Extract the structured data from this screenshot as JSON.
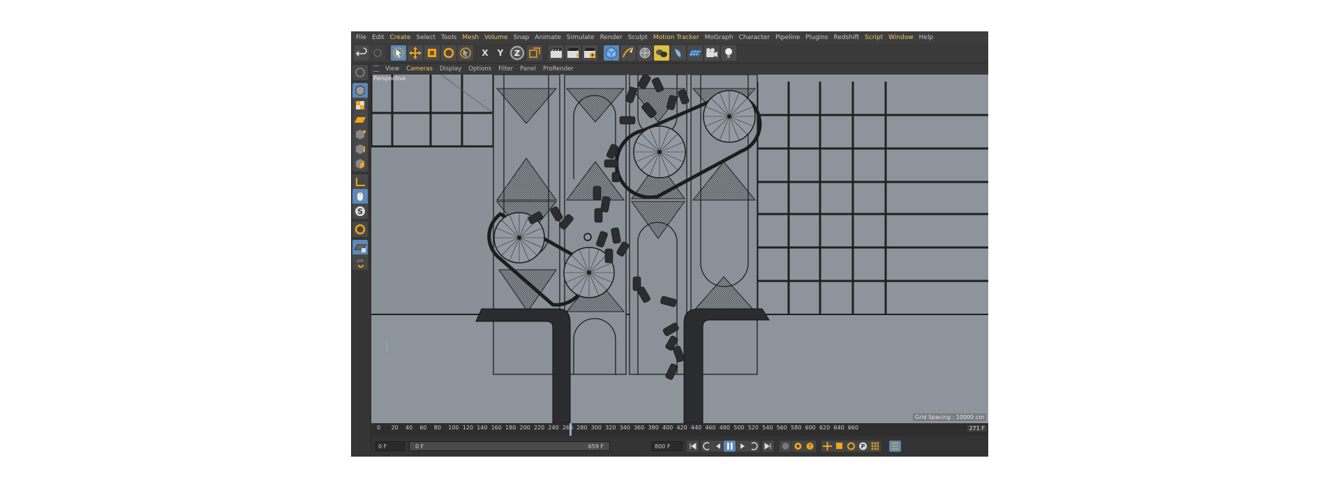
{
  "menu": [
    "File",
    "Edit",
    "Create",
    "Select",
    "Tools",
    "Mesh",
    "Volume",
    "Snap",
    "Animate",
    "Simulate",
    "Render",
    "Sculpt",
    "Motion Tracker",
    "MoGraph",
    "Character",
    "Pipeline",
    "Plugins",
    "Redshift",
    "Script",
    "Window",
    "Help"
  ],
  "menu_highlight": [
    "Create",
    "Mesh",
    "Volume",
    "Motion Tracker",
    "Script",
    "Window"
  ],
  "toolbar": {
    "x_label": "X",
    "y_label": "Y",
    "z_label": "Z"
  },
  "viewport_menu": [
    "View",
    "Cameras",
    "Display",
    "Options",
    "Filter",
    "Panel",
    "ProRender"
  ],
  "viewport": {
    "name": "Perspective",
    "grid_spacing": "Grid Spacing : 10000 cm"
  },
  "timeline": {
    "ticks": [
      "0",
      "20",
      "40",
      "60",
      "80",
      "100",
      "120",
      "140",
      "160",
      "180",
      "200",
      "220",
      "240",
      "260",
      "280",
      "300",
      "320",
      "340",
      "360",
      "380",
      "400",
      "420",
      "440",
      "460",
      "480",
      "500",
      "520",
      "540",
      "560",
      "580",
      "600",
      "620",
      "640",
      "660"
    ],
    "current_frame": "271 F",
    "playhead_value": 271,
    "range_max": 660
  },
  "playback": {
    "start_field": "0 F",
    "range_start": "0 F",
    "range_end": "659 F",
    "end_field": "800 F"
  },
  "colors": {
    "accent_orange": "#f2a51a",
    "active_blue": "#5d88b8",
    "viewport_bg": "#8f959c",
    "menu_highlight": "#f2c66d"
  }
}
